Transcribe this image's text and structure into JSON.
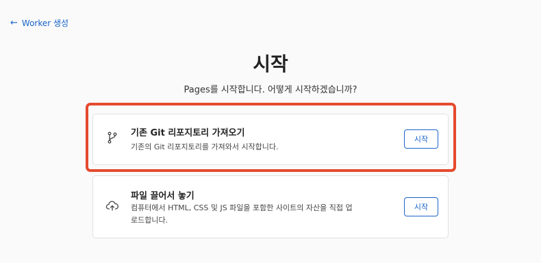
{
  "nav": {
    "back_label": "Worker 생성"
  },
  "page": {
    "title": "시작",
    "subtitle": "Pages를 시작합니다. 어떻게 시작하겠습니까?"
  },
  "options": [
    {
      "title": "기존 Git 리포지토리 가져오기",
      "description": "기존의 Git 리포지토리를 가져와서 시작합니다.",
      "button": "시작",
      "icon": "git-branch-icon"
    },
    {
      "title": "파일 끌어서 놓기",
      "description": "컴퓨터에서 HTML, CSS 및 JS 파일을 포함한 사이트의 자산을 직접 업로드합니다.",
      "button": "시작",
      "icon": "cloud-upload-icon"
    }
  ],
  "colors": {
    "accent": "#1a63c7",
    "highlight": "#e54a2e"
  }
}
